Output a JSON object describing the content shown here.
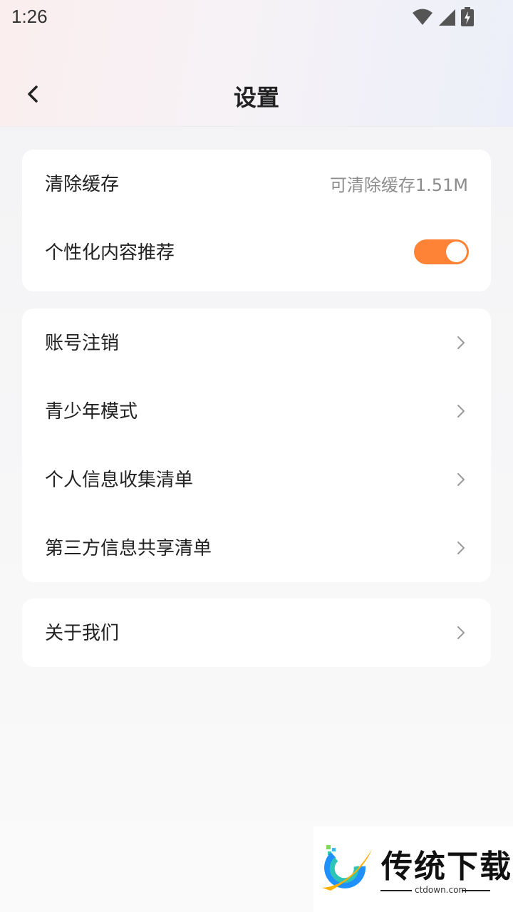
{
  "status_bar": {
    "time": "1:26",
    "icons": [
      "wifi-icon",
      "signal-icon",
      "battery-charging-icon"
    ]
  },
  "header": {
    "title": "设置",
    "back_icon": "chevron-left-icon"
  },
  "settings": {
    "group1": {
      "clear_cache": {
        "label": "清除缓存",
        "value": "可清除缓存1.51M"
      },
      "personalized": {
        "label": "个性化内容推荐",
        "toggle_on": true
      }
    },
    "group2": [
      {
        "label": "账号注销"
      },
      {
        "label": "青少年模式"
      },
      {
        "label": "个人信息收集清单"
      },
      {
        "label": "第三方信息共享清单"
      }
    ],
    "group3": [
      {
        "label": "关于我们"
      }
    ]
  },
  "watermark": {
    "name": "传统下载",
    "domain": "ctdown.com"
  },
  "colors": {
    "accent": "#ff8336",
    "background": "#f6f6f7",
    "card": "#ffffff",
    "secondary_text": "#8c8c8c"
  }
}
